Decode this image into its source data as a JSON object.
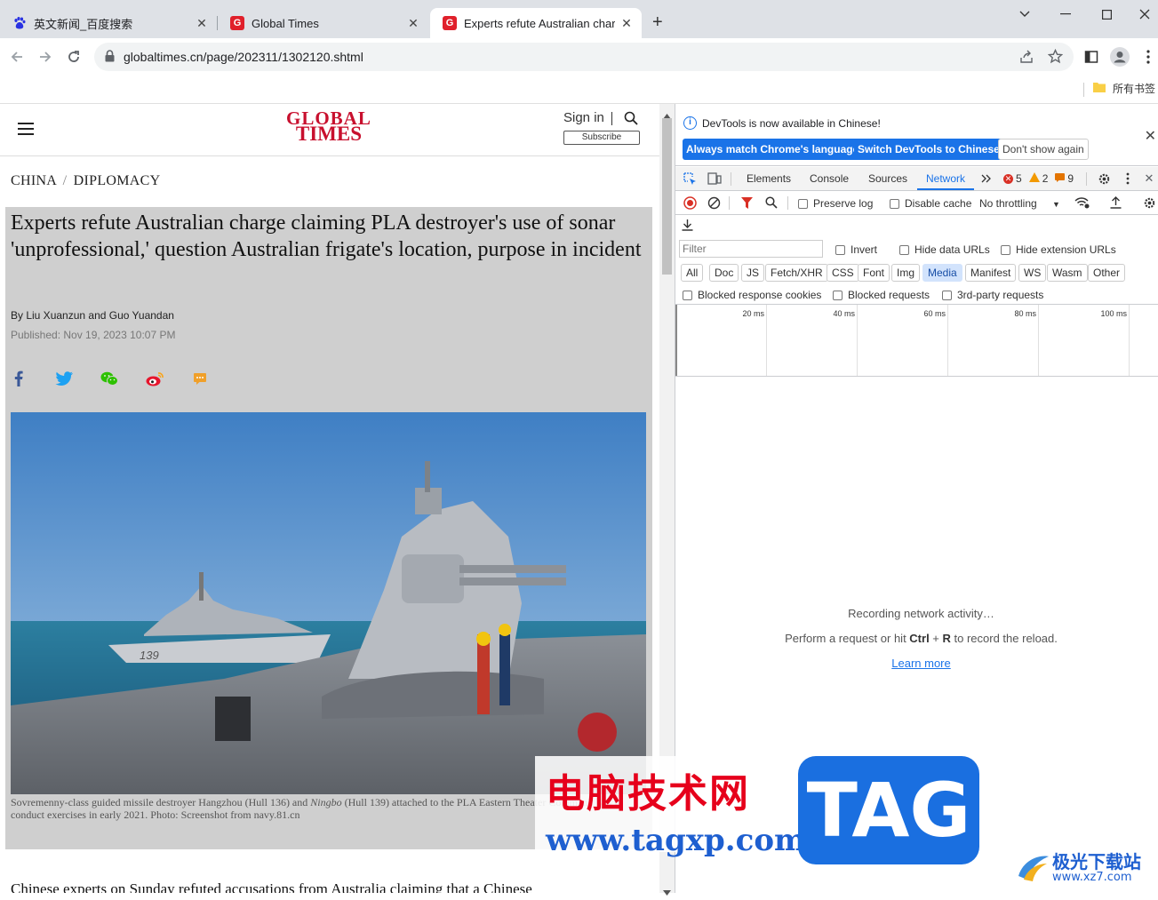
{
  "browser": {
    "tabs": [
      {
        "title": "英文新闻_百度搜索",
        "favicon": "baidu-paw",
        "favicon_color": "#2932e1"
      },
      {
        "title": "Global Times",
        "favicon": "G",
        "favicon_color": "#e0202b"
      },
      {
        "title": "Experts refute Australian char",
        "favicon": "G",
        "favicon_color": "#e0202b"
      }
    ],
    "new_tab": "+",
    "url": "globaltimes.cn/page/202311/1302120.shtml",
    "bookmarks_label": "所有书签"
  },
  "site": {
    "logo_line1": "GLOBAL",
    "logo_line2": "TIMES",
    "sign_in": "Sign in",
    "subscribe": "Subscribe",
    "breadcrumb_section": "CHINA",
    "breadcrumb_sep": "/",
    "breadcrumb_sub": "DIPLOMACY"
  },
  "article": {
    "headline": "Experts refute Australian charge claiming PLA destroyer's use of sonar 'unprofessional,' question Australian frigate's location, purpose in incident",
    "byline": "By Liu Xuanzun and Guo Yuandan",
    "published": "Published: Nov 19, 2023 10:07 PM",
    "caption_a": "Sovremenny-class guided missile destroyer Hangzhou (Hull 136) and ",
    "caption_b": "Ningbo",
    "caption_c": " (Hull 139) attached to the PLA Eastern Theater Command Navy conduct exercises in early 2021. Photo: Screenshot from navy.81.cn",
    "body_start": "Chinese experts on Sunday refuted accusations from Australia claiming that a Chinese",
    "ship_hull": "139"
  },
  "devtools": {
    "info_message": "DevTools is now available in Chinese!",
    "btn_match": "Always match Chrome's language",
    "btn_switch": "Switch DevTools to Chinese",
    "btn_dont_show": "Don't show again",
    "tabs": [
      "Elements",
      "Console",
      "Sources",
      "Network"
    ],
    "errors": "5",
    "warnings": "2",
    "issues": "9",
    "preserve_log": "Preserve log",
    "disable_cache": "Disable cache",
    "throttling": "No throttling",
    "filter_placeholder": "Filter",
    "invert": "Invert",
    "hide_data_urls": "Hide data URLs",
    "hide_extension_urls": "Hide extension URLs",
    "types": [
      "All",
      "Doc",
      "JS",
      "Fetch/XHR",
      "CSS",
      "Font",
      "Img",
      "Media",
      "Manifest",
      "WS",
      "Wasm",
      "Other"
    ],
    "active_type": "Media",
    "blocked_cookies": "Blocked response cookies",
    "blocked_requests": "Blocked requests",
    "third_party": "3rd-party requests",
    "timeline_ticks": [
      "20 ms",
      "40 ms",
      "60 ms",
      "80 ms",
      "100 ms"
    ],
    "recording": "Recording network activity…",
    "perform_a": "Perform a request or hit ",
    "perform_ctrl": "Ctrl",
    "perform_plus": " + ",
    "perform_r": "R",
    "perform_b": " to record the reload.",
    "learn_more": "Learn more"
  },
  "watermark": {
    "cn_text": "电脑技术网",
    "url": "www.tagxp.com",
    "tag": "TAG",
    "site2_cn": "极光下载站",
    "site2_url": "www.xz7.com"
  }
}
